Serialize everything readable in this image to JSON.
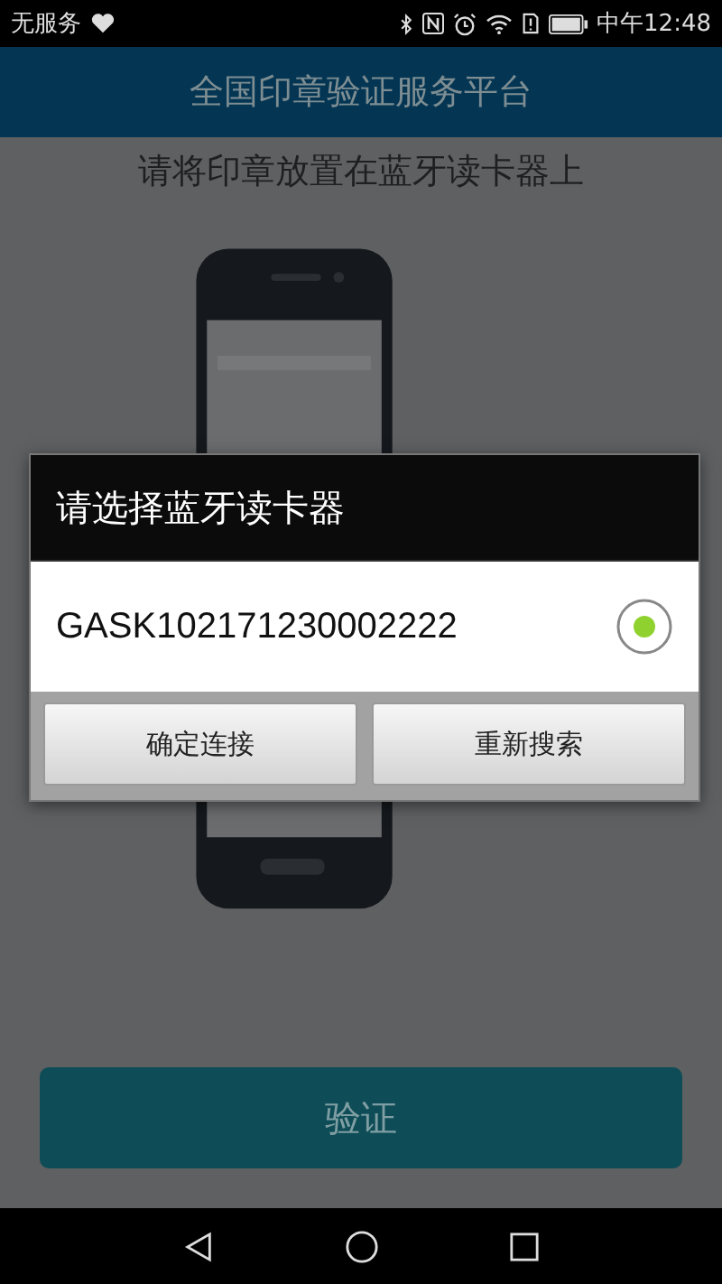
{
  "status_bar": {
    "carrier": "无服务",
    "time": "中午12:48"
  },
  "header": {
    "title": "全国印章验证服务平台"
  },
  "instruction": "请将印章放置在蓝牙读卡器上",
  "verify_button": "验证",
  "dialog": {
    "title": "请选择蓝牙读卡器",
    "devices": [
      {
        "name": "GASK102171230002222",
        "selected": true
      }
    ],
    "buttons": [
      "确定连接",
      "重新搜索"
    ]
  }
}
